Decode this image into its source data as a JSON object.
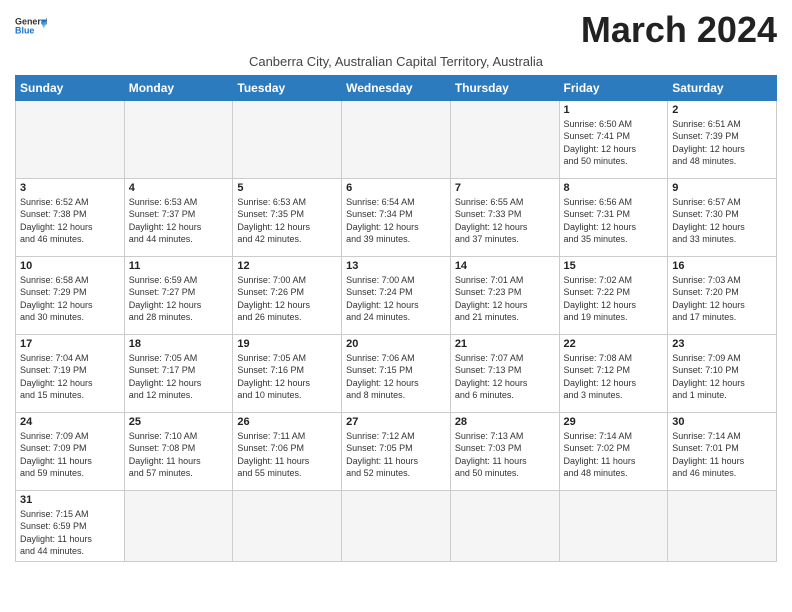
{
  "header": {
    "logo_general": "General",
    "logo_blue": "Blue",
    "month_title": "March 2024",
    "subtitle": "Canberra City, Australian Capital Territory, Australia"
  },
  "days_of_week": [
    "Sunday",
    "Monday",
    "Tuesday",
    "Wednesday",
    "Thursday",
    "Friday",
    "Saturday"
  ],
  "weeks": [
    [
      {
        "day": "",
        "info": ""
      },
      {
        "day": "",
        "info": ""
      },
      {
        "day": "",
        "info": ""
      },
      {
        "day": "",
        "info": ""
      },
      {
        "day": "",
        "info": ""
      },
      {
        "day": "1",
        "info": "Sunrise: 6:50 AM\nSunset: 7:41 PM\nDaylight: 12 hours\nand 50 minutes."
      },
      {
        "day": "2",
        "info": "Sunrise: 6:51 AM\nSunset: 7:39 PM\nDaylight: 12 hours\nand 48 minutes."
      }
    ],
    [
      {
        "day": "3",
        "info": "Sunrise: 6:52 AM\nSunset: 7:38 PM\nDaylight: 12 hours\nand 46 minutes."
      },
      {
        "day": "4",
        "info": "Sunrise: 6:53 AM\nSunset: 7:37 PM\nDaylight: 12 hours\nand 44 minutes."
      },
      {
        "day": "5",
        "info": "Sunrise: 6:53 AM\nSunset: 7:35 PM\nDaylight: 12 hours\nand 42 minutes."
      },
      {
        "day": "6",
        "info": "Sunrise: 6:54 AM\nSunset: 7:34 PM\nDaylight: 12 hours\nand 39 minutes."
      },
      {
        "day": "7",
        "info": "Sunrise: 6:55 AM\nSunset: 7:33 PM\nDaylight: 12 hours\nand 37 minutes."
      },
      {
        "day": "8",
        "info": "Sunrise: 6:56 AM\nSunset: 7:31 PM\nDaylight: 12 hours\nand 35 minutes."
      },
      {
        "day": "9",
        "info": "Sunrise: 6:57 AM\nSunset: 7:30 PM\nDaylight: 12 hours\nand 33 minutes."
      }
    ],
    [
      {
        "day": "10",
        "info": "Sunrise: 6:58 AM\nSunset: 7:29 PM\nDaylight: 12 hours\nand 30 minutes."
      },
      {
        "day": "11",
        "info": "Sunrise: 6:59 AM\nSunset: 7:27 PM\nDaylight: 12 hours\nand 28 minutes."
      },
      {
        "day": "12",
        "info": "Sunrise: 7:00 AM\nSunset: 7:26 PM\nDaylight: 12 hours\nand 26 minutes."
      },
      {
        "day": "13",
        "info": "Sunrise: 7:00 AM\nSunset: 7:24 PM\nDaylight: 12 hours\nand 24 minutes."
      },
      {
        "day": "14",
        "info": "Sunrise: 7:01 AM\nSunset: 7:23 PM\nDaylight: 12 hours\nand 21 minutes."
      },
      {
        "day": "15",
        "info": "Sunrise: 7:02 AM\nSunset: 7:22 PM\nDaylight: 12 hours\nand 19 minutes."
      },
      {
        "day": "16",
        "info": "Sunrise: 7:03 AM\nSunset: 7:20 PM\nDaylight: 12 hours\nand 17 minutes."
      }
    ],
    [
      {
        "day": "17",
        "info": "Sunrise: 7:04 AM\nSunset: 7:19 PM\nDaylight: 12 hours\nand 15 minutes."
      },
      {
        "day": "18",
        "info": "Sunrise: 7:05 AM\nSunset: 7:17 PM\nDaylight: 12 hours\nand 12 minutes."
      },
      {
        "day": "19",
        "info": "Sunrise: 7:05 AM\nSunset: 7:16 PM\nDaylight: 12 hours\nand 10 minutes."
      },
      {
        "day": "20",
        "info": "Sunrise: 7:06 AM\nSunset: 7:15 PM\nDaylight: 12 hours\nand 8 minutes."
      },
      {
        "day": "21",
        "info": "Sunrise: 7:07 AM\nSunset: 7:13 PM\nDaylight: 12 hours\nand 6 minutes."
      },
      {
        "day": "22",
        "info": "Sunrise: 7:08 AM\nSunset: 7:12 PM\nDaylight: 12 hours\nand 3 minutes."
      },
      {
        "day": "23",
        "info": "Sunrise: 7:09 AM\nSunset: 7:10 PM\nDaylight: 12 hours\nand 1 minute."
      }
    ],
    [
      {
        "day": "24",
        "info": "Sunrise: 7:09 AM\nSunset: 7:09 PM\nDaylight: 11 hours\nand 59 minutes."
      },
      {
        "day": "25",
        "info": "Sunrise: 7:10 AM\nSunset: 7:08 PM\nDaylight: 11 hours\nand 57 minutes."
      },
      {
        "day": "26",
        "info": "Sunrise: 7:11 AM\nSunset: 7:06 PM\nDaylight: 11 hours\nand 55 minutes."
      },
      {
        "day": "27",
        "info": "Sunrise: 7:12 AM\nSunset: 7:05 PM\nDaylight: 11 hours\nand 52 minutes."
      },
      {
        "day": "28",
        "info": "Sunrise: 7:13 AM\nSunset: 7:03 PM\nDaylight: 11 hours\nand 50 minutes."
      },
      {
        "day": "29",
        "info": "Sunrise: 7:14 AM\nSunset: 7:02 PM\nDaylight: 11 hours\nand 48 minutes."
      },
      {
        "day": "30",
        "info": "Sunrise: 7:14 AM\nSunset: 7:01 PM\nDaylight: 11 hours\nand 46 minutes."
      }
    ],
    [
      {
        "day": "31",
        "info": "Sunrise: 7:15 AM\nSunset: 6:59 PM\nDaylight: 11 hours\nand 44 minutes."
      },
      {
        "day": "",
        "info": ""
      },
      {
        "day": "",
        "info": ""
      },
      {
        "day": "",
        "info": ""
      },
      {
        "day": "",
        "info": ""
      },
      {
        "day": "",
        "info": ""
      },
      {
        "day": "",
        "info": ""
      }
    ]
  ]
}
